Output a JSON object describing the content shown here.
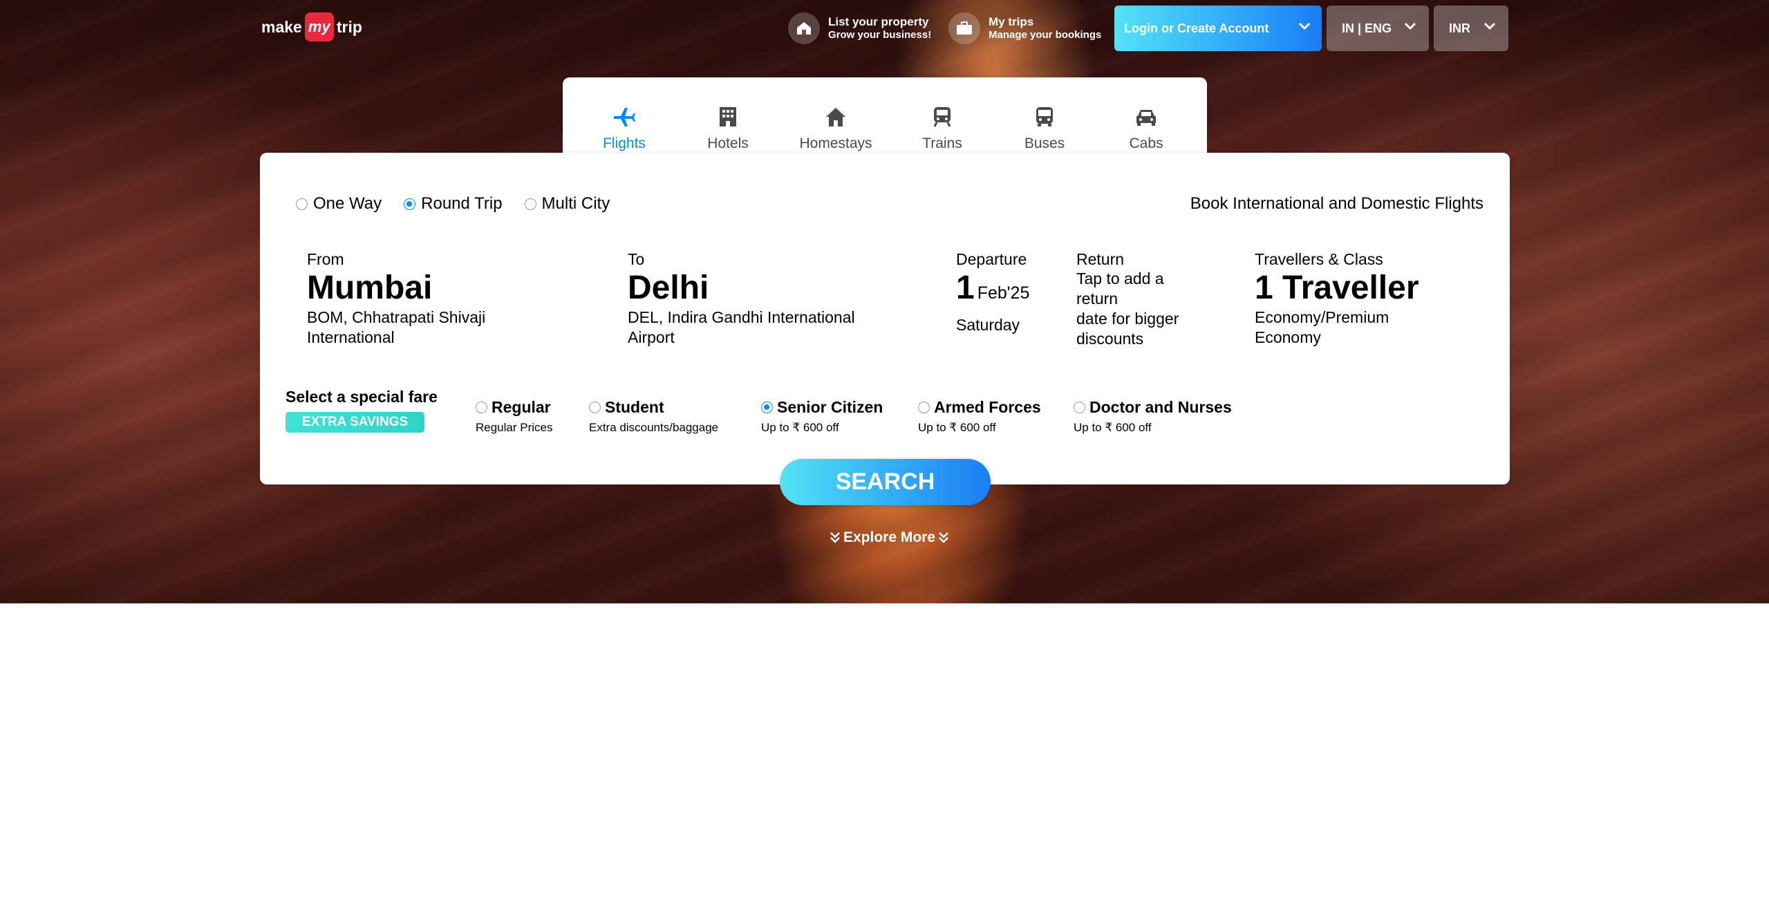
{
  "header": {
    "logo": {
      "make": "make",
      "my": "my",
      "trip": "trip"
    },
    "list_property": {
      "title": "List your property",
      "subtitle": "Grow your business!",
      "icon": "house-icon"
    },
    "my_trips": {
      "title": "My trips",
      "subtitle": "Manage your bookings",
      "icon": "briefcase-icon"
    },
    "login_label": "Login or Create Account",
    "language_label": "IN | ENG",
    "currency_label": "INR"
  },
  "tabs": [
    {
      "label": "Flights",
      "icon": "plane-icon",
      "active": true
    },
    {
      "label": "Hotels",
      "icon": "building-icon",
      "active": false
    },
    {
      "label": "Homestays",
      "icon": "home-icon",
      "active": false
    },
    {
      "label": "Trains",
      "icon": "train-icon",
      "active": false
    },
    {
      "label": "Buses",
      "icon": "bus-icon",
      "active": false
    },
    {
      "label": "Cabs",
      "icon": "car-icon",
      "active": false
    }
  ],
  "trip_types": [
    {
      "label": "One Way",
      "checked": false
    },
    {
      "label": "Round Trip",
      "checked": true
    },
    {
      "label": "Multi City",
      "checked": false
    }
  ],
  "book_info": "Book International and Domestic Flights",
  "from": {
    "label": "From",
    "city": "Mumbai",
    "airport_line1": "BOM, Chhatrapati Shivaji",
    "airport_line2": "International"
  },
  "to": {
    "label": "To",
    "city": "Delhi",
    "airport_line1": "DEL, Indira Gandhi International",
    "airport_line2": "Airport"
  },
  "departure": {
    "label": "Departure",
    "day": "1",
    "month_year": "Feb'25",
    "weekday": "Saturday"
  },
  "return": {
    "label": "Return",
    "line1": "Tap to add a",
    "line2": "return",
    "line3": "date for bigger",
    "line4": "discounts"
  },
  "travellers": {
    "label": "Travellers & Class",
    "value": "1 Traveller",
    "class_line1": "Economy/Premium",
    "class_line2": "Economy"
  },
  "special_fare": {
    "title": "Select a special fare",
    "badge": "EXTRA SAVINGS",
    "options": [
      {
        "label": "Regular",
        "desc": "Regular Prices",
        "checked": false
      },
      {
        "label": "Student",
        "desc": "Extra discounts/baggage",
        "checked": false
      },
      {
        "label": "Senior Citizen",
        "desc": "Up to ₹ 600 off",
        "checked": true
      },
      {
        "label": "Armed Forces",
        "desc": "Up to ₹ 600 off",
        "checked": false
      },
      {
        "label": "Doctor and Nurses",
        "desc": "Up to ₹ 600 off",
        "checked": false
      }
    ]
  },
  "search_label": "SEARCH",
  "explore_label": "Explore More",
  "colors": {
    "accent": "#008cff",
    "brand_red": "#e8283d",
    "teal_badge": "#43e1d5"
  }
}
